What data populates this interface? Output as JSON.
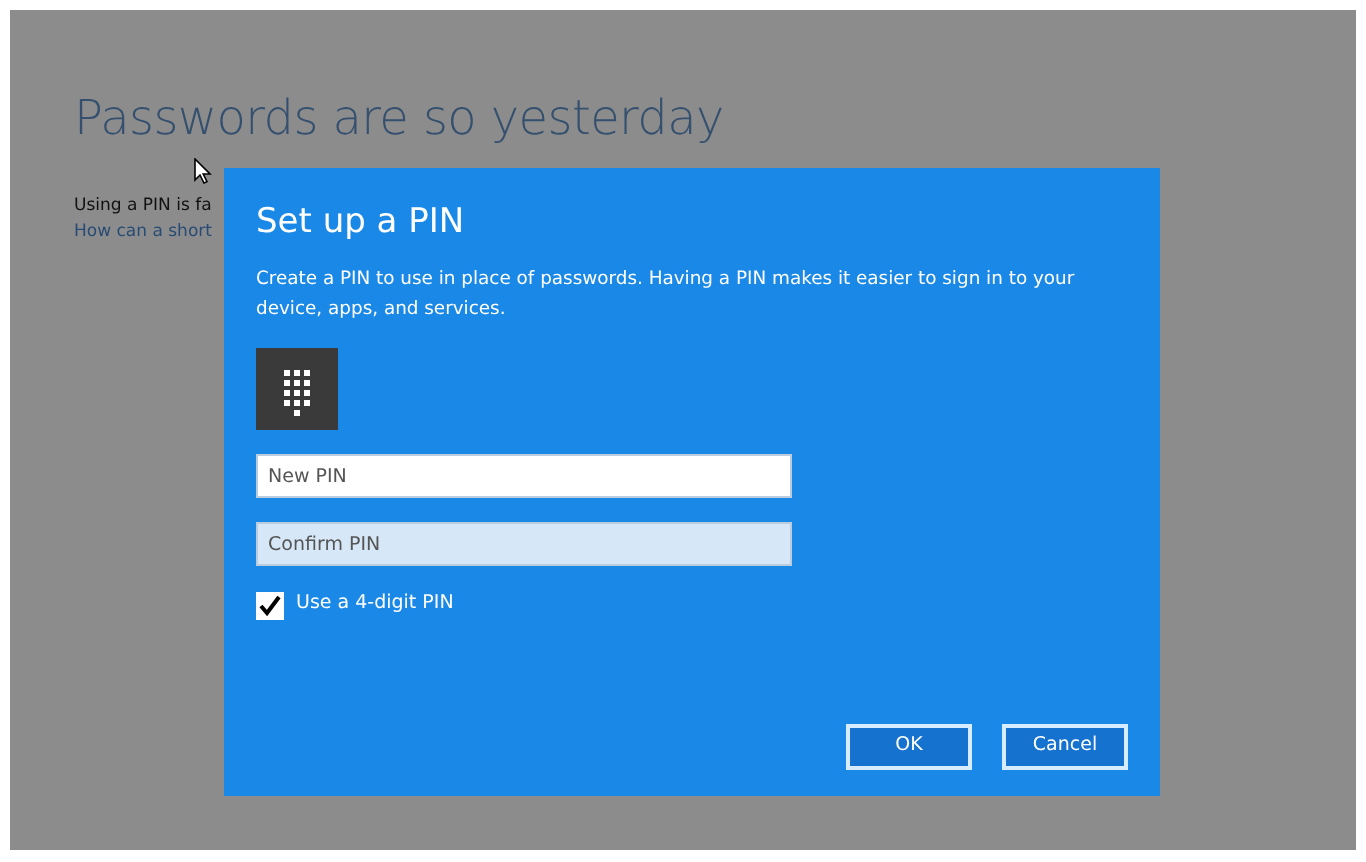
{
  "page": {
    "title": "Passwords are so yesterday",
    "body": "Using a PIN is fa",
    "link": "How can a short"
  },
  "dialog": {
    "title": "Set up a PIN",
    "description": "Create a PIN to use in place of passwords. Having a PIN makes it easier to sign in to your device, apps, and services.",
    "fields": [
      {
        "placeholder": "New PIN",
        "kind": "plain"
      },
      {
        "placeholder": "Confirm PIN",
        "kind": "tinted"
      }
    ],
    "checkbox": {
      "label": "Use a 4-digit PIN",
      "checked": true
    },
    "buttons": [
      "OK",
      "Cancel"
    ]
  }
}
